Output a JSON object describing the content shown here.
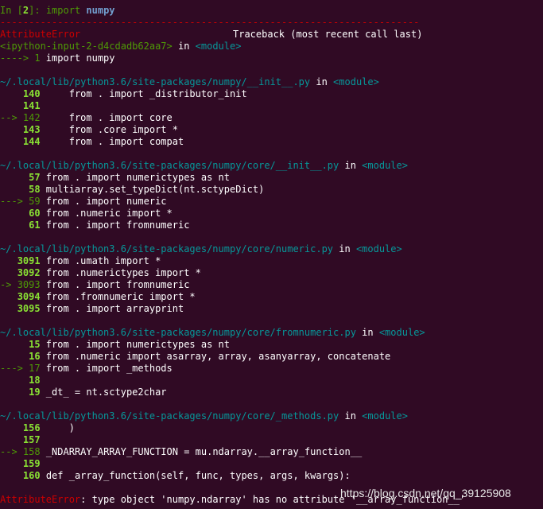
{
  "prompt": {
    "in": "In [",
    "num": "2",
    "close": "]: ",
    "cmd": "import ",
    "mod": "numpy"
  },
  "separator": "-------------------------------------------------------------------------",
  "error_header": {
    "name": "AttributeError",
    "traceback": "Traceback (most recent call last)"
  },
  "input_ref": {
    "file": "<ipython-input-2-d4cdadb62aa7>",
    "in": " in ",
    "module": "<module>"
  },
  "input_line": {
    "arrow": "----> 1 ",
    "code": "import numpy"
  },
  "frames": [
    {
      "path": "~/.local/lib/python3.6/site-packages/numpy/__init__.py",
      "module": "<module>",
      "lines": [
        {
          "prefix": "    ",
          "num": "140",
          "code": "     from . import _distributor_init"
        },
        {
          "prefix": "    ",
          "num": "141",
          "code": ""
        },
        {
          "prefix": "--> ",
          "num": "142",
          "code": "     from . import core"
        },
        {
          "prefix": "    ",
          "num": "143",
          "code": "     from .core import *"
        },
        {
          "prefix": "    ",
          "num": "144",
          "code": "     from . import compat"
        }
      ]
    },
    {
      "path": "~/.local/lib/python3.6/site-packages/numpy/core/__init__.py",
      "module": "<module>",
      "lines": [
        {
          "prefix": "     ",
          "num": "57",
          "code": " from . import numerictypes as nt"
        },
        {
          "prefix": "     ",
          "num": "58",
          "code": " multiarray.set_typeDict(nt.sctypeDict)"
        },
        {
          "prefix": "---> ",
          "num": "59",
          "code": " from . import numeric"
        },
        {
          "prefix": "     ",
          "num": "60",
          "code": " from .numeric import *"
        },
        {
          "prefix": "     ",
          "num": "61",
          "code": " from . import fromnumeric"
        }
      ]
    },
    {
      "path": "~/.local/lib/python3.6/site-packages/numpy/core/numeric.py",
      "module": "<module>",
      "lines": [
        {
          "prefix": "   ",
          "num": "3091",
          "code": " from .umath import *"
        },
        {
          "prefix": "   ",
          "num": "3092",
          "code": " from .numerictypes import *"
        },
        {
          "prefix": "-> ",
          "num": "3093",
          "code": " from . import fromnumeric"
        },
        {
          "prefix": "   ",
          "num": "3094",
          "code": " from .fromnumeric import *"
        },
        {
          "prefix": "   ",
          "num": "3095",
          "code": " from . import arrayprint"
        }
      ]
    },
    {
      "path": "~/.local/lib/python3.6/site-packages/numpy/core/fromnumeric.py",
      "module": "<module>",
      "lines": [
        {
          "prefix": "     ",
          "num": "15",
          "code": " from . import numerictypes as nt"
        },
        {
          "prefix": "     ",
          "num": "16",
          "code": " from .numeric import asarray, array, asanyarray, concatenate"
        },
        {
          "prefix": "---> ",
          "num": "17",
          "code": " from . import _methods"
        },
        {
          "prefix": "     ",
          "num": "18",
          "code": ""
        },
        {
          "prefix": "     ",
          "num": "19",
          "code": " _dt_ = nt.sctype2char"
        }
      ]
    },
    {
      "path": "~/.local/lib/python3.6/site-packages/numpy/core/_methods.py",
      "module": "<module>",
      "lines": [
        {
          "prefix": "    ",
          "num": "156",
          "code": "     )"
        },
        {
          "prefix": "    ",
          "num": "157",
          "code": ""
        },
        {
          "prefix": "--> ",
          "num": "158",
          "code": " _NDARRAY_ARRAY_FUNCTION = mu.ndarray.__array_function__"
        },
        {
          "prefix": "    ",
          "num": "159",
          "code": ""
        },
        {
          "prefix": "    ",
          "num": "160",
          "code": " def _array_function(self, func, types, args, kwargs):"
        }
      ]
    }
  ],
  "final_error": {
    "name": "AttributeError",
    "message": ": type object 'numpy.ndarray' has no attribute '__array_function__'"
  },
  "watermark": "https://blog.csdn.net/qq_39125908",
  "colors": {
    "background": "#300a24",
    "error": "#cc0000",
    "prompt": "#4e9a06",
    "path": "#06989a",
    "module": "#3465a4",
    "lineno": "#8ae234"
  }
}
